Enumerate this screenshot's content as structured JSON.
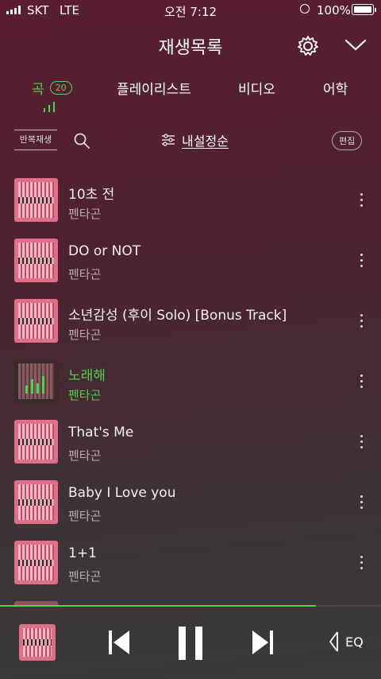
{
  "status": {
    "carrier": "SKT",
    "network": "LTE",
    "time": "오전 7:12",
    "battery": "100%"
  },
  "header": {
    "title": "재생목록"
  },
  "tabs": {
    "song": "곡",
    "song_count": "20",
    "playlist": "플레이리스트",
    "video": "비디오",
    "language": "어학"
  },
  "toolbar": {
    "repeat": "반복재생",
    "sort": "내설정순",
    "edit": "편집"
  },
  "songs": [
    {
      "title": "10초 전",
      "artist": "펜타곤"
    },
    {
      "title": "DO or NOT",
      "artist": "펜타곤"
    },
    {
      "title": "소년감성 (후이 Solo) [Bonus Track]",
      "artist": "펜타곤"
    },
    {
      "title": "노래해",
      "artist": "펜타곤"
    },
    {
      "title": "That's Me",
      "artist": "펜타곤"
    },
    {
      "title": "Baby I Love you",
      "artist": "펜타곤"
    },
    {
      "title": "1+1",
      "artist": "펜타곤"
    }
  ],
  "player": {
    "eq_label": "EQ",
    "progress": 0.83
  },
  "colors": {
    "accent": "#4cd44c",
    "background": "#5a1e30"
  }
}
